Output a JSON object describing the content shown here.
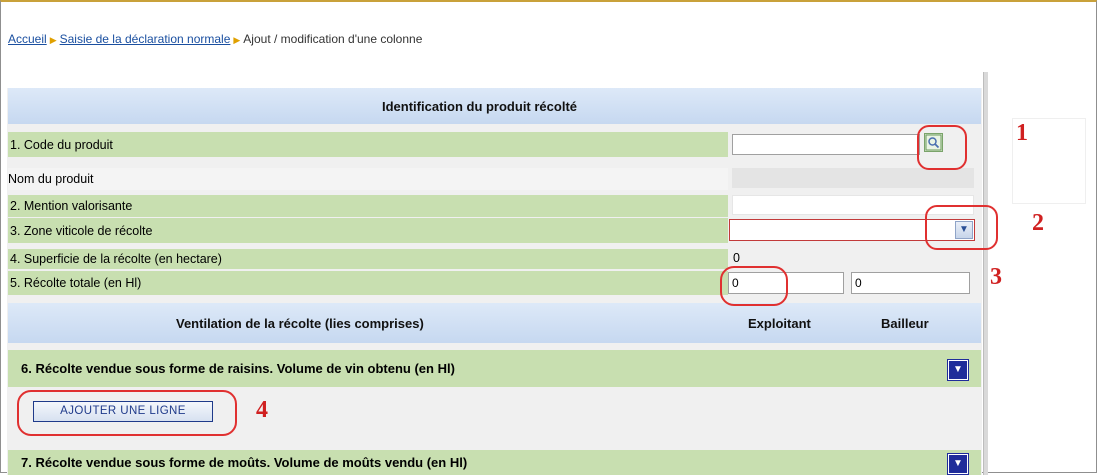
{
  "breadcrumb": {
    "home": "Accueil",
    "declaration": "Saisie de la déclaration normale",
    "current": "Ajout / modification d'une colonne"
  },
  "identification": {
    "title": "Identification du produit récolté",
    "rows": [
      {
        "label": "1. Code du produit",
        "value": ""
      },
      {
        "label": "Nom du produit",
        "value": ""
      },
      {
        "label": "2. Mention valorisante",
        "value": ""
      },
      {
        "label": "3. Zone viticole de récolte",
        "value": ""
      },
      {
        "label": "4. Superficie de la récolte (en hectare)",
        "value": "0"
      },
      {
        "label": "5. Récolte totale (en Hl)",
        "value": "0",
        "value2": "0"
      }
    ]
  },
  "ventilation": {
    "title": "Ventilation de la récolte (lies comprises)",
    "col_exploitant": "Exploitant",
    "col_bailleur": "Bailleur"
  },
  "section6": {
    "label": "6. Récolte vendue sous forme de raisins. Volume de vin obtenu (en Hl)",
    "add_button": "AJOUTER UNE LIGNE"
  },
  "section7": {
    "label": "7. Récolte vendue sous forme de moûts. Volume de moûts vendu (en Hl)"
  },
  "annotations": [
    "1",
    "2",
    "3",
    "4"
  ],
  "icons": {
    "search": "search-icon",
    "dropdown": "chevron-down-icon",
    "toggle": "triangle-down-icon"
  },
  "colors": {
    "section_header": "#c6d8f0",
    "row_green": "#c8dfb0",
    "callout": "#e03030",
    "toggle": "#1f2d9a"
  }
}
